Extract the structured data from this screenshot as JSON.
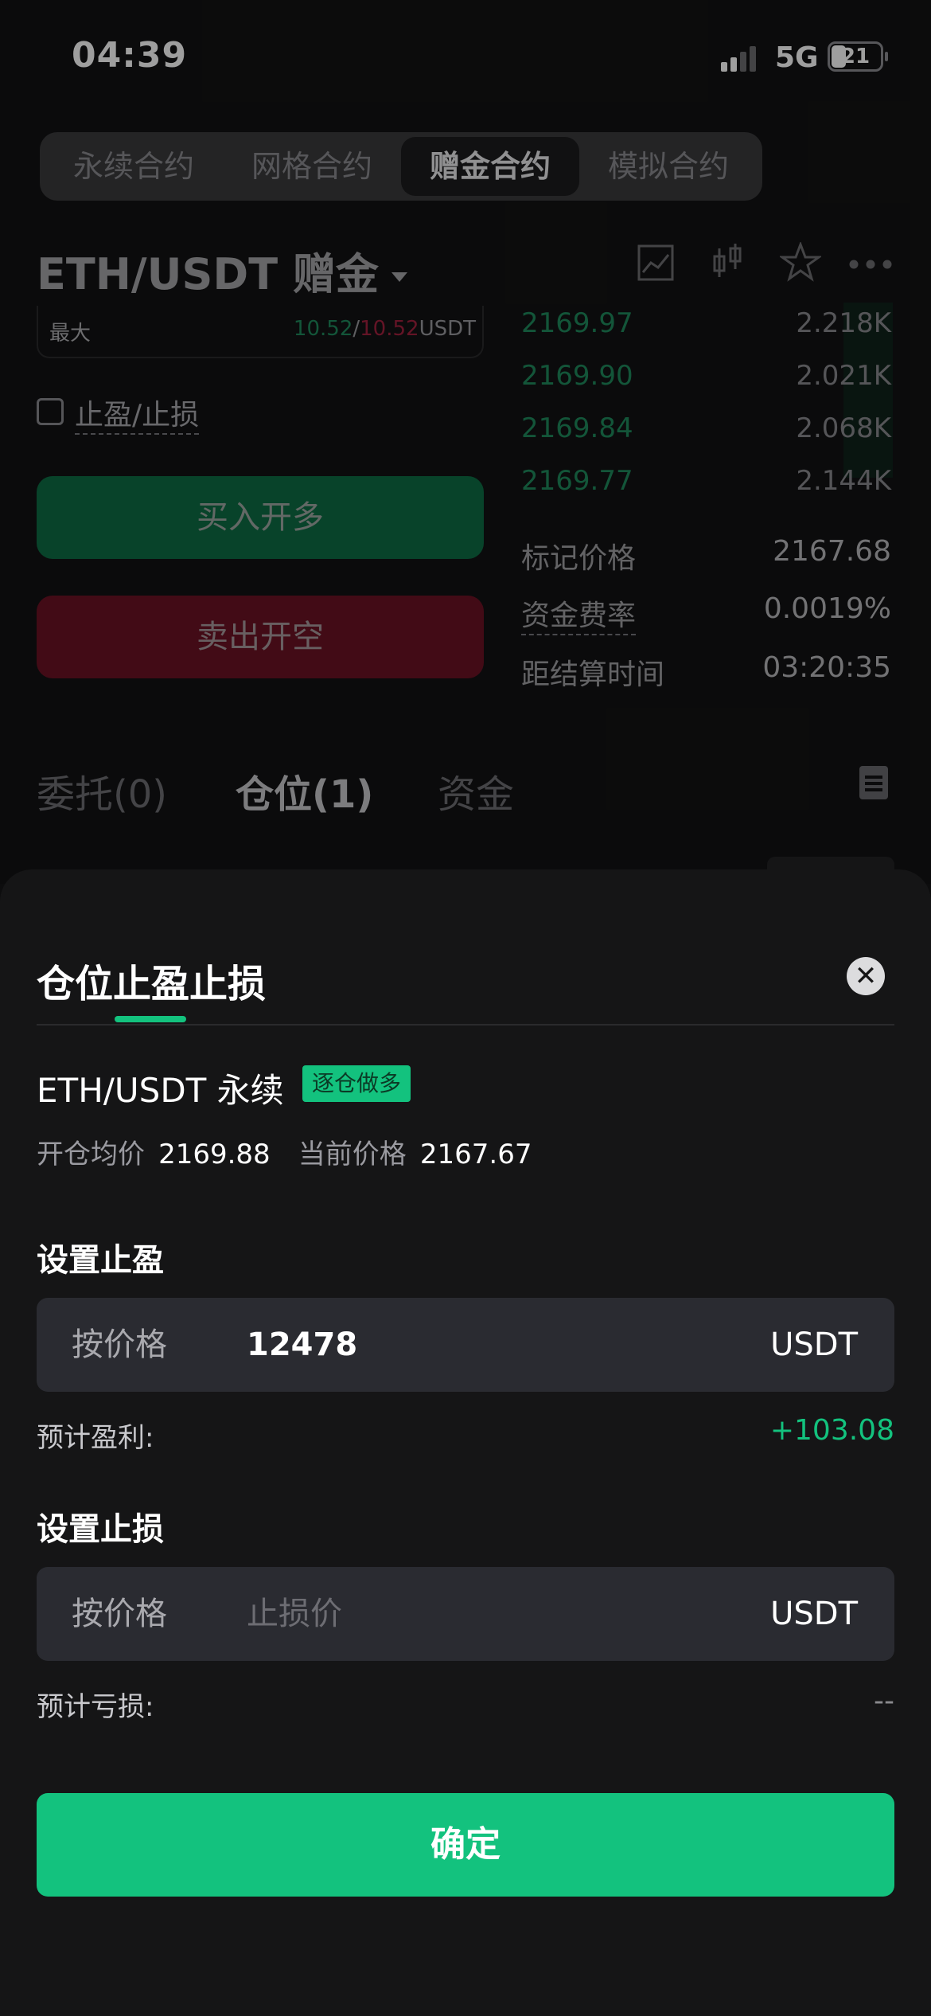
{
  "status": {
    "time": "04:39",
    "network": "5G",
    "battery": "21"
  },
  "tabs": [
    {
      "label": "永续合约"
    },
    {
      "label": "网格合约"
    },
    {
      "label": "赠金合约"
    },
    {
      "label": "模拟合约"
    }
  ],
  "pair": {
    "title": "ETH/USDT 赠金"
  },
  "order_form": {
    "max_label": "最大",
    "max_buy": "10.52",
    "separator": "/",
    "max_sell": "10.52",
    "unit": "USDT",
    "tpsl_label": "止盈/止损",
    "buy_label": "买入开多",
    "sell_label": "卖出开空"
  },
  "orderbook": [
    {
      "price": "2169.97",
      "size": "2.218K"
    },
    {
      "price": "2169.90",
      "size": "2.021K"
    },
    {
      "price": "2169.84",
      "size": "2.068K"
    },
    {
      "price": "2169.77",
      "size": "2.144K"
    }
  ],
  "market_info": {
    "mark_label": "标记价格",
    "mark_value": "2167.68",
    "funding_label": "资金费率",
    "funding_value": "0.0019%",
    "settle_label": "距结算时间",
    "settle_value": "03:20:35"
  },
  "position_tabs": [
    {
      "label": "委托(0)"
    },
    {
      "label": "仓位(1)"
    },
    {
      "label": "资金"
    }
  ],
  "sheet": {
    "title": "仓位止盈止损",
    "pair": "ETH/USDT 永续",
    "badge": "逐仓做多",
    "open_label": "开仓均价",
    "open_value": "2169.88",
    "current_label": "当前价格",
    "current_value": "2167.67",
    "tp_section": "设置止盈",
    "tp_mode": "按价格",
    "tp_value": "12478",
    "tp_unit": "USDT",
    "profit_label": "预计盈利:",
    "profit_value": "+103.08",
    "sl_section": "设置止损",
    "sl_mode": "按价格",
    "sl_placeholder": "止损价",
    "sl_unit": "USDT",
    "loss_label": "预计亏损:",
    "loss_value": "--",
    "confirm_label": "确定"
  },
  "colors": {
    "accent": "#13c27e",
    "buy": "#0e6d45",
    "sell": "#6b1325"
  }
}
